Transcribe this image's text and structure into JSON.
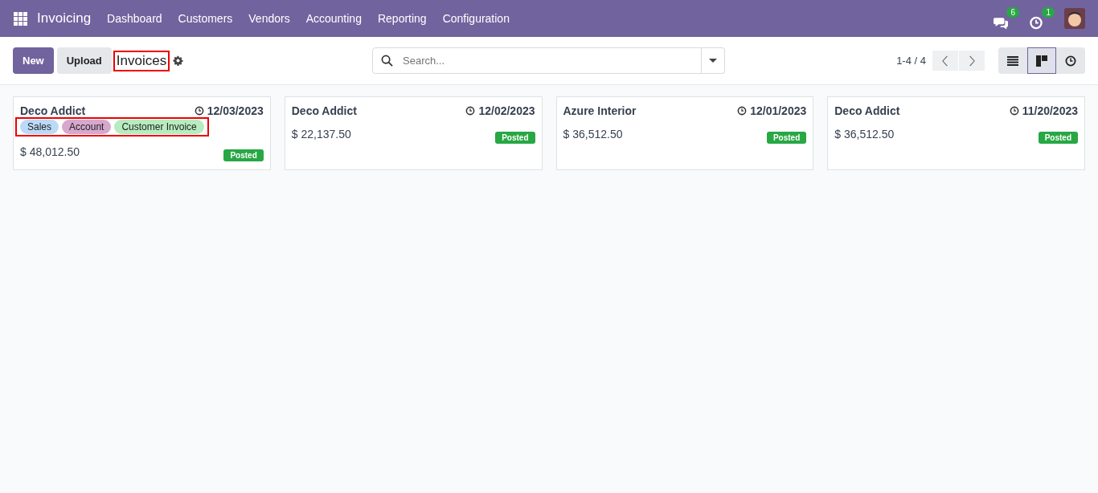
{
  "navbar": {
    "app": "Invoicing",
    "menu": [
      "Dashboard",
      "Customers",
      "Vendors",
      "Accounting",
      "Reporting",
      "Configuration"
    ],
    "messages_count": "6",
    "activities_count": "1"
  },
  "control_panel": {
    "buttons": [
      {
        "label": "New",
        "kind": "primary"
      },
      {
        "label": "Upload",
        "kind": "secondary"
      }
    ],
    "title": "Invoices",
    "title_highlighted": true,
    "search": {
      "placeholder": "Search..."
    },
    "pager": "1-4 / 4",
    "views": [
      {
        "kind": "list",
        "selected": false
      },
      {
        "kind": "kanban",
        "selected": true
      },
      {
        "kind": "activity",
        "selected": false
      }
    ]
  },
  "cards": [
    {
      "partner": "Deco Addict",
      "date": "12/03/2023",
      "tags": [
        {
          "label": "Sales",
          "color": "#bcdaf7"
        },
        {
          "label": "Account",
          "color": "#d7a8ce"
        },
        {
          "label": "Customer Invoice",
          "color": "#b7ecbf"
        }
      ],
      "tags_highlighted": true,
      "amount": "$ 48,012.50",
      "status": "Posted"
    },
    {
      "partner": "Deco Addict",
      "date": "12/02/2023",
      "amount": "$ 22,137.50",
      "status": "Posted"
    },
    {
      "partner": "Azure Interior",
      "date": "12/01/2023",
      "amount": "$ 36,512.50",
      "status": "Posted"
    },
    {
      "partner": "Deco Addict",
      "date": "11/20/2023",
      "amount": "$ 36,512.50",
      "status": "Posted"
    }
  ]
}
